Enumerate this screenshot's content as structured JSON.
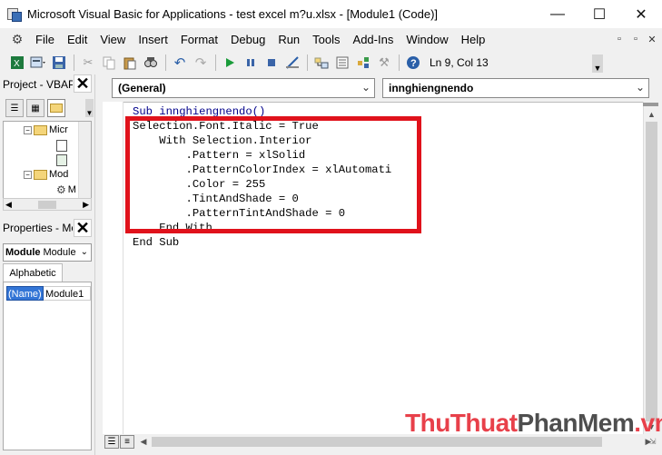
{
  "window": {
    "title": "Microsoft Visual Basic for Applications - test excel m?u.xlsx - [Module1 (Code)]",
    "minimize": "—",
    "maximize": "☐",
    "close": "✕"
  },
  "menu": {
    "items": [
      "File",
      "Edit",
      "View",
      "Insert",
      "Format",
      "Debug",
      "Run",
      "Tools",
      "Add-Ins",
      "Window",
      "Help"
    ],
    "right": [
      "▫",
      "▫",
      "✕"
    ]
  },
  "toolbar": {
    "status": "Ln 9, Col 13"
  },
  "project_pane": {
    "title": "Project - VBAPr",
    "tree": [
      {
        "label": "Micr"
      },
      {
        "label": ""
      },
      {
        "label": "Mod"
      },
      {
        "label": "M"
      }
    ]
  },
  "properties_pane": {
    "title": "Properties - Mo",
    "object_name": "Module",
    "object_type": "Module",
    "tab": "Alphabetic",
    "rows": [
      {
        "name": "(Name)",
        "value": "Module1"
      }
    ]
  },
  "code_window": {
    "object_combo": "(General)",
    "proc_combo": "innghiengnendo",
    "lines": [
      "Sub innghiengnendo()",
      "Selection.Font.Italic = True",
      "    With Selection.Interior",
      "        .Pattern = xlSolid",
      "        .PatternColorIndex = xlAutomati",
      "        .Color = 255",
      "        .TintAndShade = 0",
      "        .PatternTintAndShade = 0",
      "    End With",
      "End Sub"
    ]
  },
  "watermark": {
    "part1": "ThuThuat",
    "part2": "PhanMem",
    "part3": ".vn"
  },
  "colors": {
    "highlight_box": "#e0121b",
    "selection": "#3375d6",
    "keyword": "#00008b"
  }
}
